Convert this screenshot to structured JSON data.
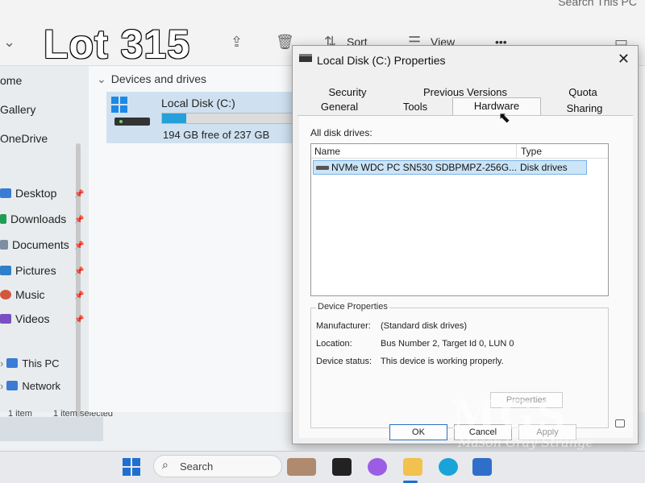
{
  "watermark": {
    "lot": "Lot 315",
    "brand_mark": "MGS",
    "brand_sub": "Mason Gray Strange"
  },
  "explorer": {
    "search_hint": "Search This PC",
    "toolbar": {
      "sort_label": "Sort",
      "view_label": "View",
      "more_label": "•••"
    },
    "sidebar": {
      "items": [
        {
          "label": "Home",
          "icon": "home-icon",
          "pinned": false
        },
        {
          "label": "Gallery",
          "icon": "gallery-icon",
          "pinned": false
        },
        {
          "label": "OneDrive",
          "icon": "cloud-icon",
          "pinned": false
        },
        {
          "label": "Desktop",
          "icon": "desktop-icon",
          "pinned": true
        },
        {
          "label": "Downloads",
          "icon": "download-icon",
          "pinned": true
        },
        {
          "label": "Documents",
          "icon": "documents-icon",
          "pinned": true
        },
        {
          "label": "Pictures",
          "icon": "pictures-icon",
          "pinned": true
        },
        {
          "label": "Music",
          "icon": "music-icon",
          "pinned": true
        },
        {
          "label": "Videos",
          "icon": "videos-icon",
          "pinned": true
        },
        {
          "label": "This PC",
          "icon": "computer-icon",
          "pinned": false
        },
        {
          "label": "Network",
          "icon": "network-icon",
          "pinned": false
        }
      ],
      "display": [
        "ome",
        "Gallery",
        "OneDrive",
        "Desktop",
        "Downloads",
        "Documents",
        "Pictures",
        "Music",
        "Videos",
        "This PC",
        "Network"
      ]
    },
    "status": {
      "item_count": "1 item",
      "selected": "1 item selected"
    },
    "section_header": "Devices and drives",
    "drive": {
      "name": "Local Disk (C:)",
      "free_text": "194 GB free of 237 GB",
      "used_fraction": 0.18
    }
  },
  "dialog": {
    "title": "Local Disk (C:) Properties",
    "close_glyph": "✕",
    "tabs_row1": [
      "Security",
      "Previous Versions",
      "Quota"
    ],
    "tabs_row2": [
      "General",
      "Tools",
      "Hardware",
      "Sharing"
    ],
    "active_tab": "Hardware",
    "all_disk_drives_label": "All disk drives:",
    "columns": {
      "name": "Name",
      "type": "Type"
    },
    "drives": [
      {
        "name": "NVMe WDC PC SN530 SDBPMPZ-256G...",
        "type": "Disk drives"
      }
    ],
    "device_properties": {
      "group_title": "Device Properties",
      "manufacturer_label": "Manufacturer:",
      "manufacturer_value": "(Standard disk drives)",
      "location_label": "Location:",
      "location_value": "Bus Number 2, Target Id 0, LUN 0",
      "status_label": "Device status:",
      "status_value": "This device is working properly."
    },
    "buttons": {
      "properties": "Properties",
      "ok": "OK",
      "cancel": "Cancel",
      "apply": "Apply"
    }
  },
  "taskbar": {
    "search_label": "Search"
  },
  "colors": {
    "accent": "#26a0da",
    "selection": "#cce4f7",
    "drive_tile": "#cfe1f0"
  }
}
